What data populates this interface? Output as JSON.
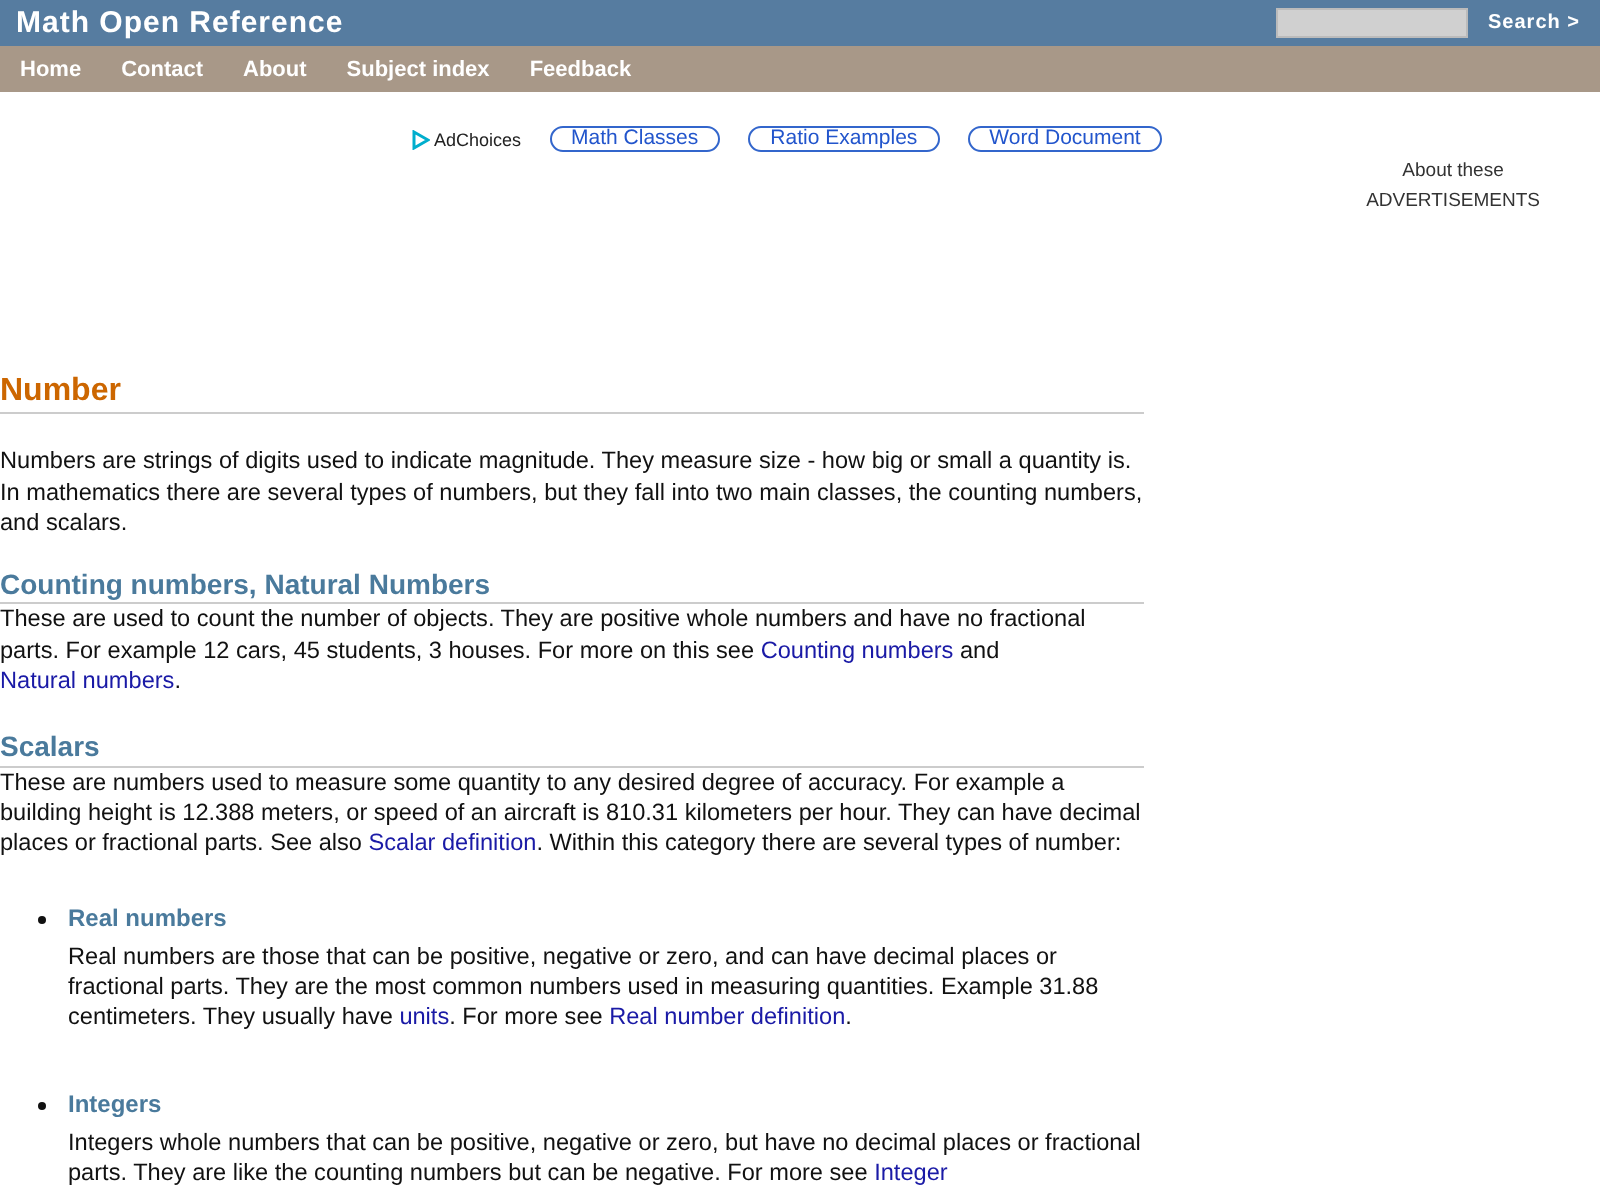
{
  "site_title": "Math Open Reference",
  "search": {
    "button": "Search >"
  },
  "nav": [
    "Home",
    "Contact",
    "About",
    "Subject index",
    "Feedback"
  ],
  "ads": {
    "adchoices": "AdChoices",
    "links": [
      "Math Classes",
      "Ratio Examples",
      "Word Document"
    ],
    "about": "About these",
    "label": "ADVERTISEMENTS"
  },
  "title": "Number",
  "intro": [
    {
      "text": "Numbers are strings of digits used to indicate magnitude. They measure size - how big or small a quantity is. In mathematics there are several types of numbers, but they fall into two main classes, the counting numbers, and scalars."
    }
  ],
  "sections": [
    {
      "heading": "Counting numbers, Natural Numbers",
      "body": [
        {
          "text": "These are used to count the number of objects. They are positive whole numbers and have no fractional parts. For example 12 cars, 45 students, 3 houses. For more on this see "
        },
        {
          "link": "Counting numbers"
        },
        {
          "text": " and "
        },
        {
          "link": "Natural numbers"
        },
        {
          "text": "."
        }
      ]
    },
    {
      "heading": "Scalars",
      "body": [
        {
          "text": "These are numbers used to measure some quantity to any desired degree of accuracy. For example a building height is 12.388 meters, or speed of an aircraft is 810.31 kilometers per hour. They can have decimal places or fractional parts. See also "
        },
        {
          "link": "Scalar definition"
        },
        {
          "text": ". Within this category there are several types of number:"
        }
      ],
      "items": [
        {
          "heading": "Real numbers",
          "body": [
            {
              "text": "Real numbers are those that can be positive, negative or zero, and can have decimal places or fractional parts. They are the most common numbers used in measuring quantities. Example 31.88 centimeters. They usually have "
            },
            {
              "link": "units"
            },
            {
              "text": ". For more see "
            },
            {
              "link": "Real number definition"
            },
            {
              "text": "."
            }
          ]
        },
        {
          "heading": "Integers",
          "body": [
            {
              "text": "Integers whole numbers that can be positive, negative or zero, but have no decimal places or fractional parts. They are like the counting numbers but can be negative. For more see "
            },
            {
              "link": "Integer"
            }
          ]
        }
      ]
    }
  ]
}
